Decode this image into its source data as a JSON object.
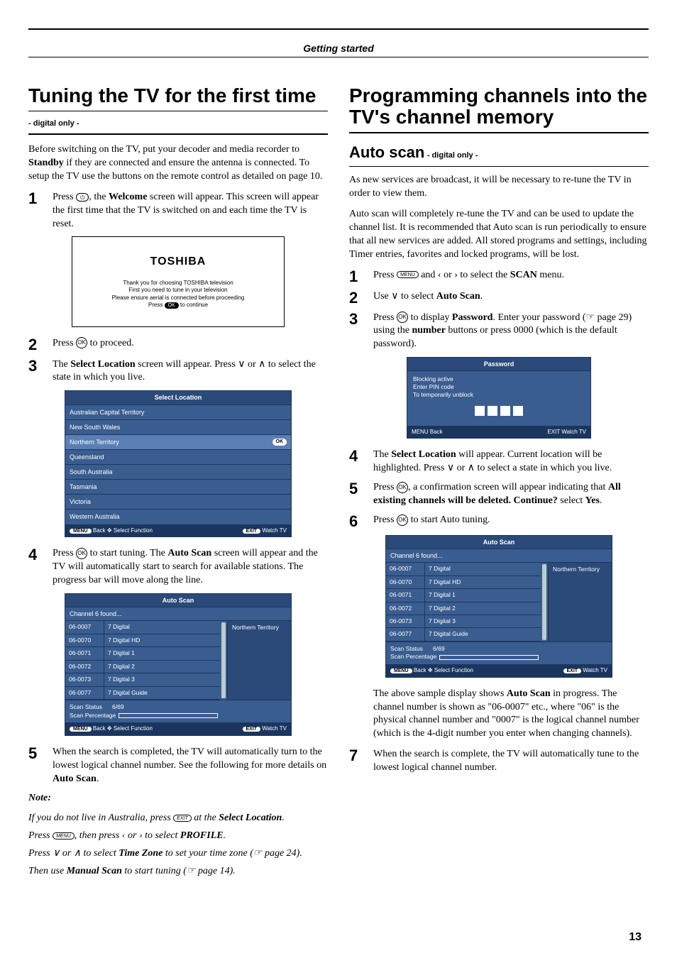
{
  "header": {
    "section": "Getting started"
  },
  "page_number": "13",
  "left": {
    "h1": "Tuning the TV for the first time",
    "hsub": "- digital only -",
    "intro": "Before switching on the TV, put your decoder and media recorder to ",
    "intro_bold": "Standby",
    "intro2": " if they are connected and ensure the antenna is connected. To setup the TV use the buttons on the remote control as detailed on page 10.",
    "s1a": "Press ",
    "s1_key": "⏻",
    "s1b": ", the ",
    "s1_bold": "Welcome",
    "s1c": " screen will appear. This screen will appear the first time that the TV is switched on and each time the TV is reset.",
    "welcome": {
      "brand": "TOSHIBA",
      "l1": "Thank you for choosing TOSHIBA television",
      "l2": "First you need to tune in your television",
      "l3": "Please ensure aerial is connected before proceeding",
      "l4a": "Press ",
      "l4_ok": "OK",
      "l4b": " to continue"
    },
    "s2a": "Press ",
    "s2_ok": "OK",
    "s2b": " to proceed.",
    "s3a": "The ",
    "s3_bold": "Select Location",
    "s3b": " screen will appear. Press ∨ or ∧ to select the state in which you live.",
    "loc": {
      "title": "Select Location",
      "items": [
        "Australian Capital Territory",
        "New South Wales",
        "Northern Territory",
        "Queensland",
        "South Australia",
        "Tasmania",
        "Victoria",
        "Western Australia"
      ],
      "selected_index": 2,
      "ok": "OK",
      "foot_menu": "MENU",
      "foot_back": "Back",
      "foot_sel": "Select Function",
      "foot_exit": "EXIT",
      "foot_watch": "Watch TV"
    },
    "s4a": "Press ",
    "s4_ok": "OK",
    "s4b": " to start tuning. The ",
    "s4_bold": "Auto Scan",
    "s4c": " screen will appear and the TV will automatically start to search for available stations. The progress bar will move along the line.",
    "scan": {
      "title": "Auto Scan",
      "sub": "Channel 6 found...",
      "rows": [
        [
          "06-0007",
          "7 Digital"
        ],
        [
          "06-0070",
          "7 Digital HD"
        ],
        [
          "06-0071",
          "7 Digital 1"
        ],
        [
          "06-0072",
          "7 Digital 2"
        ],
        [
          "06-0073",
          "7 Digital 3"
        ],
        [
          "06-0077",
          "7 Digital Guide"
        ]
      ],
      "region": "Northern Territory",
      "status_label": "Scan Status",
      "status_value": "6/69",
      "percent_label": "Scan Percentage",
      "foot_menu": "MENU",
      "foot_back": "Back",
      "foot_sel": "Select Function",
      "foot_exit": "EXIT",
      "foot_watch": "Watch TV"
    },
    "s5": "When the search is completed, the TV will automatically turn to the lowest logical channel number. See the following for more details on ",
    "s5_bold": "Auto Scan",
    "s5b": ".",
    "note_hd": "Note:",
    "note1a": "If you do not live in Australia, press ",
    "note1_exit": "EXIT",
    "note1b": " at the ",
    "note1_bold": "Select Location",
    "note1c": ".",
    "note2a": "Press ",
    "note2_menu": "MENU",
    "note2b": ", then press ‹ or › to select ",
    "note2_bold": "PROFILE",
    "note2c": ".",
    "note3a": "Press ∨ or ∧ to select ",
    "note3_bold": "Time Zone",
    "note3b": " to set your time zone (☞ page 24).",
    "note4a": "Then use ",
    "note4_bold": "Manual Scan",
    "note4b": " to start tuning (☞ page 14)."
  },
  "right": {
    "h1": "Programming channels into the TV's channel memory",
    "h2": "Auto scan",
    "h2sub": " - digital only -",
    "p1": "As new services are broadcast, it will be necessary to re-tune the TV in order to view them.",
    "p2": "Auto scan will completely re-tune the TV and can be used to update the channel list. It is recommended that Auto scan is run periodically to ensure that all new services are added. All stored programs and settings, including Timer entries, favorites and locked programs, will be lost.",
    "s1a": "Press ",
    "s1_menu": "MENU",
    "s1b": " and ‹ or › to select the ",
    "s1_bold": "SCAN",
    "s1c": " menu.",
    "s2a": "Use ∨ to select ",
    "s2_bold": "Auto Scan",
    "s2b": ".",
    "s3a": "Press ",
    "s3_ok": "OK",
    "s3b": " to display ",
    "s3_bold": "Password",
    "s3c": ". Enter your password (☞ page 29) using the ",
    "s3_bold2": "number",
    "s3d": " buttons or press 0000 (which is the default password).",
    "pwd": {
      "title": "Password",
      "l1": "Blocking active",
      "l2": "Enter PIN code",
      "l3": "To temporarily unblock",
      "foot_menu": "MENU",
      "foot_back": "Back",
      "foot_exit": "EXIT",
      "foot_watch": "Watch TV"
    },
    "s4a": "The ",
    "s4_bold": "Select Location",
    "s4b": " will appear. Current location will be highlighted. Press ∨ or ∧ to select a state in which you live.",
    "s5a": "Press ",
    "s5_ok": "OK",
    "s5b": ", a confirmation screen will appear indicating that ",
    "s5_bold": "All existing channels will be deleted. Continue?",
    "s5c": " select ",
    "s5_bold2": "Yes",
    "s5d": ".",
    "s6a": "Press ",
    "s6_ok": "OK",
    "s6b": " to start Auto tuning.",
    "scan_caption1": "The above sample display shows ",
    "scan_caption1_bold": "Auto Scan",
    "scan_caption1b": " in progress. The channel number is shown as \"06-0007\" etc., where \"06\" is the physical channel number and \"0007\" is the logical channel number (which is the 4-digit number you enter when changing channels).",
    "s7": "When the search is complete, the TV will automatically tune to the lowest logical channel number."
  }
}
